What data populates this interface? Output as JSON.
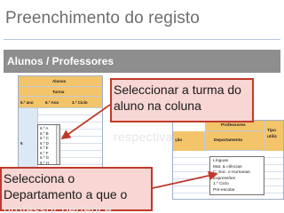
{
  "slide": {
    "title": "Preenchimento do registo",
    "subtitle": "Alunos / Professores"
  },
  "left_sheet": {
    "header_alunos": "Alunos",
    "header_turma": "Turma",
    "col_5ano": "5.º ano",
    "col_6ano": "6.º Ano",
    "col_3ciclo": "3.º Ciclo",
    "row_labels": [
      "5"
    ]
  },
  "dropdown_turmas": {
    "options": [
      "6.º A",
      "6.º B",
      "6.º C",
      "6.º D",
      "6.º E",
      "6.º F",
      "6.º G",
      "6.º H"
    ]
  },
  "right_sheet": {
    "header_professores": "Professores",
    "header_tipo": "Tipo",
    "header_utiliz": "utiliz",
    "header_departamento": "Departamento",
    "header_cao": "ção"
  },
  "dropdown_departamentos": {
    "options": [
      "Línguas",
      "Mat. & ciências",
      "C. Soc. e Humanas",
      "Expressões",
      "1.º Ciclo",
      "Pré-escolar"
    ]
  },
  "callouts": {
    "turma_text": "Seleccionar a turma do aluno na coluna",
    "turma_overflow": "respectiva.",
    "departamento_text": "Selecciona o Departamento a que o",
    "departamento_overflow": "professor pertence"
  },
  "colors": {
    "callout_fill": "#f7d6d4",
    "callout_border": "#c0392b",
    "sheet_header": "#f4c46a",
    "subtitle_bar": "#8e8e8e"
  }
}
